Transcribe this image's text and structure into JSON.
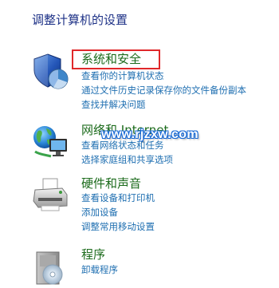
{
  "heading": "调整计算机的设置",
  "categories": [
    {
      "title": "系统和安全",
      "links": [
        "查看你的计算机状态",
        "通过文件历史记录保存你的文件备份副本",
        "查找并解决问题"
      ]
    },
    {
      "title": "网络和 Internet",
      "links": [
        "查看网络状态和任务",
        "选择家庭组和共享选项"
      ]
    },
    {
      "title": "硬件和声音",
      "links": [
        "查看设备和打印机",
        "添加设备",
        "调整常用移动设置"
      ]
    },
    {
      "title": "程序",
      "links": [
        "卸载程序"
      ]
    }
  ],
  "watermark": "www.rjzxw.com",
  "colors": {
    "category_title": "#1c6b1c",
    "link": "#1f6fb1",
    "heading": "#1e3287",
    "highlight_box": "#e0282a"
  },
  "icons": [
    "shield-icon",
    "network-globe-icon",
    "printer-icon",
    "programs-icon"
  ]
}
